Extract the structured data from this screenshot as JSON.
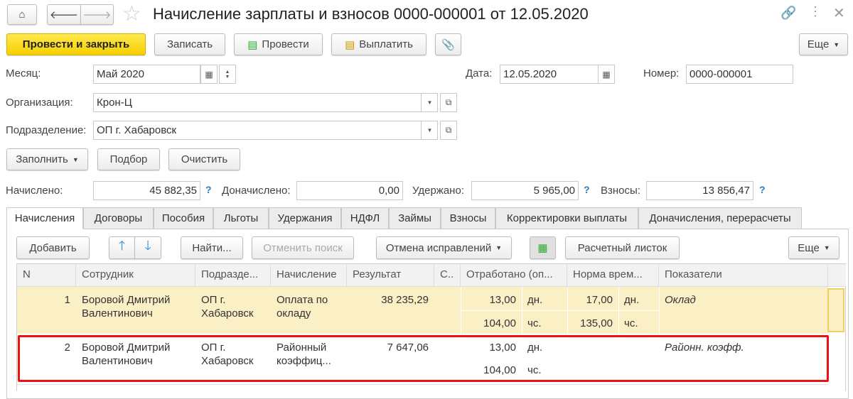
{
  "header": {
    "title": "Начисление зарплаты и взносов 0000-000001 от 12.05.2020"
  },
  "toolbar": {
    "post_close": "Провести и закрыть",
    "save": "Записать",
    "post": "Провести",
    "pay": "Выплатить",
    "more": "Еще"
  },
  "form": {
    "month_label": "Месяц:",
    "month_value": "Май 2020",
    "date_label": "Дата:",
    "date_value": "12.05.2020",
    "number_label": "Номер:",
    "number_value": "0000-000001",
    "org_label": "Организация:",
    "org_value": "Крон-Ц",
    "dept_label": "Подразделение:",
    "dept_value": "ОП г. Хабаровск",
    "fill": "Заполнить",
    "select": "Подбор",
    "clear": "Очистить",
    "accrued_label": "Начислено:",
    "accrued_value": "45 882,35",
    "extra_label": "Доначислено:",
    "extra_value": "0,00",
    "withheld_label": "Удержано:",
    "withheld_value": "5 965,00",
    "contrib_label": "Взносы:",
    "contrib_value": "13 856,47",
    "help": "?"
  },
  "tabs": [
    "Начисления",
    "Договоры",
    "Пособия",
    "Льготы",
    "Удержания",
    "НДФЛ",
    "Займы",
    "Взносы",
    "Корректировки выплаты",
    "Доначисления, перерасчеты"
  ],
  "table_toolbar": {
    "add": "Добавить",
    "find": "Найти...",
    "cancel_search": "Отменить поиск",
    "cancel_fix": "Отмена исправлений",
    "payslip": "Расчетный листок",
    "more": "Еще"
  },
  "columns": [
    "N",
    "Сотрудник",
    "Подразде...",
    "Начисление",
    "Результат",
    "С..",
    "Отработано (оп...",
    "Норма врем...",
    "Показатели"
  ],
  "rows": [
    {
      "n": "1",
      "employee": "Боровой Дмитрий Валентинович",
      "dept": "ОП г. Хабаровск",
      "accrual": "Оплата по окладу",
      "result": "38 235,29",
      "worked_days": "13,00",
      "days_unit": "дн.",
      "worked_hours": "104,00",
      "hours_unit": "чс.",
      "norm_days": "17,00",
      "norm_days_unit": "дн.",
      "norm_hours": "135,00",
      "norm_hours_unit": "чс.",
      "indicators": "Оклад"
    },
    {
      "n": "2",
      "employee": "Боровой Дмитрий Валентинович",
      "dept": "ОП г. Хабаровск",
      "accrual": "Районный коэффиц...",
      "result": "7 647,06",
      "worked_days": "13,00",
      "days_unit": "дн.",
      "worked_hours": "104,00",
      "hours_unit": "чс.",
      "indicators": "Районн. коэфф."
    }
  ]
}
